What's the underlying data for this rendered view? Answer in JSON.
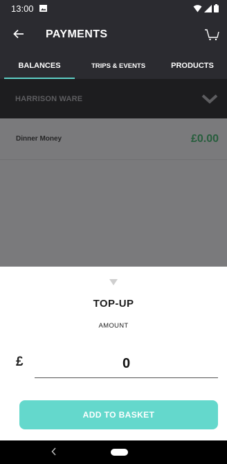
{
  "status_bar": {
    "time": "13:00",
    "icons": [
      "image-icon",
      "wifi-icon",
      "signal-icon",
      "battery-icon"
    ]
  },
  "app_bar": {
    "title": "PAYMENTS",
    "back_icon": "arrow-left-icon",
    "cart_icon": "cart-icon"
  },
  "tabs": [
    {
      "label": "BALANCES",
      "active": true
    },
    {
      "label": "TRIPS & EVENTS",
      "active": false
    },
    {
      "label": "PRODUCTS",
      "active": false
    }
  ],
  "child": {
    "name": "HARRISON WARE",
    "icon": "chevron-down-icon"
  },
  "balances": [
    {
      "label": "Dinner Money",
      "amount": "£0.00"
    }
  ],
  "sheet": {
    "title": "TOP-UP",
    "subtitle": "AMOUNT",
    "currency_symbol": "£",
    "amount_value": "0",
    "button_label": "ADD TO BASKET"
  },
  "colors": {
    "header_bg": "#2b2b30",
    "tab_indicator": "#5fd1c8",
    "button_bg": "#64d8cc",
    "amount_color": "#275e3d"
  }
}
